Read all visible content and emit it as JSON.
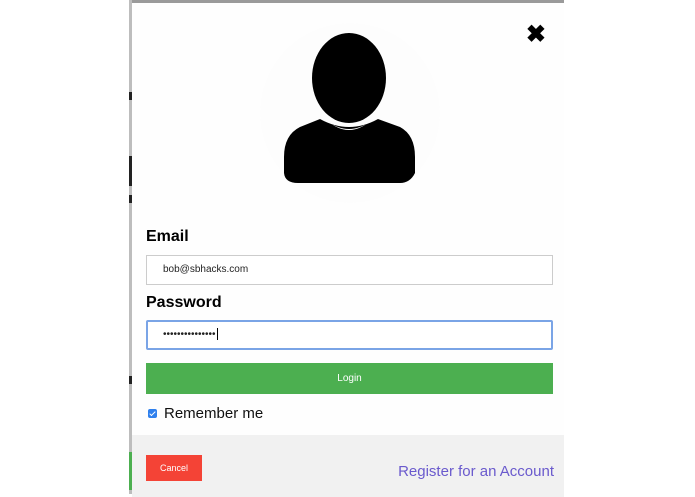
{
  "modal": {
    "close_symbol": "✖",
    "avatar_icon": "user-silhouette-icon",
    "email_label": "Email",
    "email_value": "bob@sbhacks.com",
    "password_label": "Password",
    "password_value": "•••••••••••••••",
    "login_label": "Login",
    "remember_label": "Remember me",
    "remember_checked": true,
    "cancel_label": "Cancel",
    "register_label": "Register for an Account"
  },
  "colors": {
    "login_green": "#4caf50",
    "cancel_red": "#f44336",
    "link_purple": "#6a5acd",
    "focus_blue": "#7aa4e6"
  }
}
